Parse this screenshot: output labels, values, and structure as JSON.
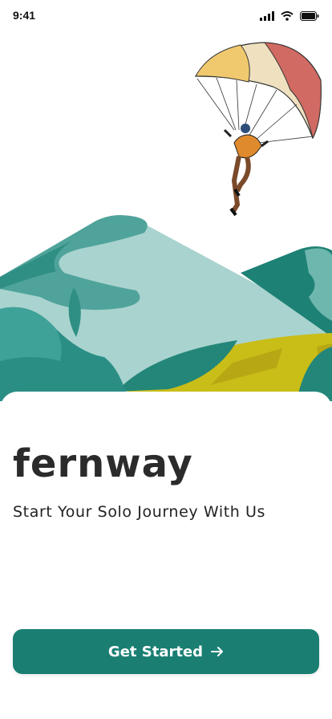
{
  "status_bar": {
    "time": "9:41",
    "icons": [
      "cellular-signal-icon",
      "wifi-icon",
      "battery-icon"
    ]
  },
  "hero": {
    "illustration": "paraglider-over-mountains",
    "colors": {
      "mountain_light": "#a9d3cf",
      "mountain_teal": "#2f8f84",
      "field_yellow": "#c9bd17",
      "canopy_red": "#d06a62",
      "canopy_yellow": "#f0c86e"
    }
  },
  "brand": {
    "name": "fernway",
    "tagline": "Start Your Solo Journey With Us"
  },
  "cta": {
    "label": "Get Started",
    "icon": "arrow-right-icon",
    "color": "#1a7f72"
  }
}
